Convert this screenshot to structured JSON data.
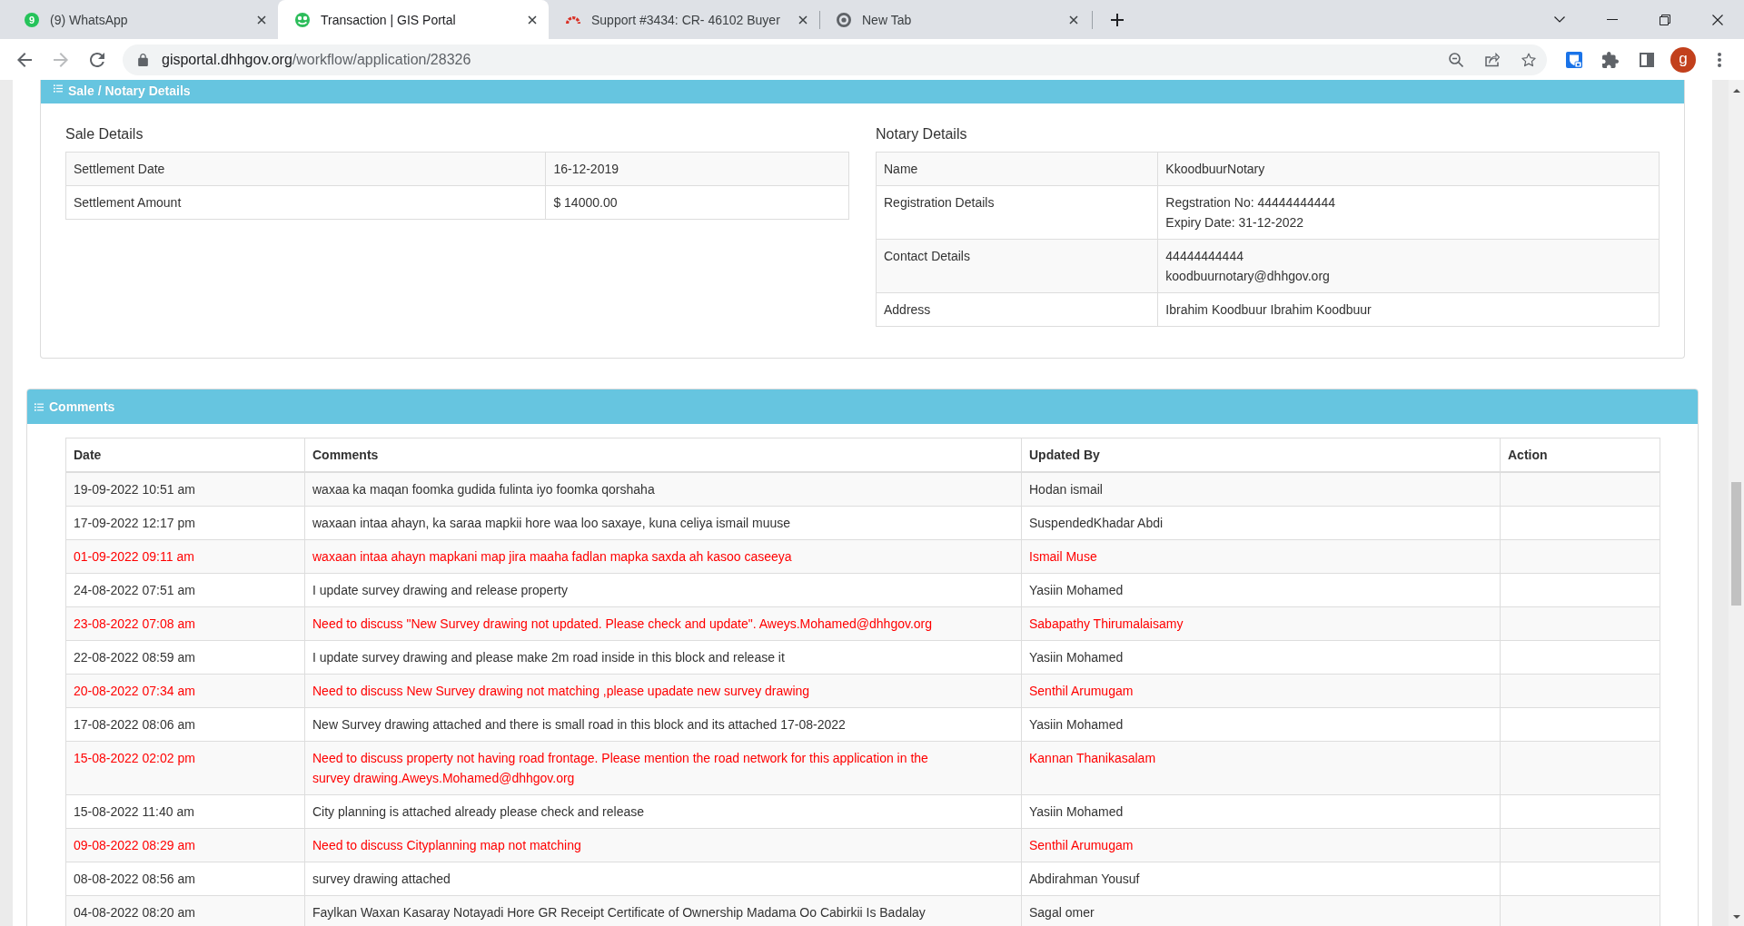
{
  "browser": {
    "tabs": [
      {
        "kind": "chat",
        "badge": "9",
        "title": "(9) WhatsApp",
        "selected": false
      },
      {
        "kind": "portal",
        "title": "Transaction | GIS Portal",
        "selected": true
      },
      {
        "kind": "gauge",
        "title": "Support #3434: CR- 46102 Buyer",
        "selected": false
      },
      {
        "kind": "browser",
        "title": "New Tab",
        "selected": false
      }
    ],
    "forward_disabled": true,
    "url": {
      "host": "gisportal.dhhgov.org",
      "path": "/workflow/application/28326"
    },
    "profile_initial": "g"
  },
  "sale_notary_panel": {
    "title": "Sale / Notary Details",
    "sale": {
      "heading": "Sale Details",
      "rows": [
        {
          "label": "Settlement Date",
          "value": [
            "16-12-2019"
          ]
        },
        {
          "label": "Settlement Amount",
          "value": [
            "$ 14000.00"
          ]
        }
      ]
    },
    "notary": {
      "heading": "Notary Details",
      "rows": [
        {
          "label": "Name",
          "value": [
            "KkoodbuurNotary"
          ]
        },
        {
          "label": "Registration Details",
          "value": [
            "Regstration No: 44444444444",
            "Expiry Date: 31-12-2022"
          ]
        },
        {
          "label": "Contact Details",
          "value": [
            "44444444444",
            "koodbuurnotary@dhhgov.org"
          ]
        },
        {
          "label": "Address",
          "value": [
            "Ibrahim Koodbuur Ibrahim Koodbuur"
          ]
        }
      ]
    }
  },
  "comments_panel": {
    "title": "Comments",
    "columns": [
      "Date",
      "Comments",
      "Updated By",
      "Action"
    ],
    "rows": [
      {
        "date": "19-09-2022 10:51 am",
        "comment": "waxaa ka maqan foomka gudida fulinta iyo foomka qorshaha",
        "updated_by": "Hodan ismail",
        "flagged": false
      },
      {
        "date": "17-09-2022 12:17 pm",
        "comment": "waxaan intaa ahayn, ka saraa mapkii hore waa loo saxaye, kuna celiya ismail muuse",
        "updated_by": "SuspendedKhadar Abdi",
        "flagged": false
      },
      {
        "date": "01-09-2022 09:11 am",
        "comment": "waxaan intaa ahayn mapkani map jira maaha fadlan mapka saxda ah kasoo caseeya",
        "updated_by": "Ismail Muse",
        "flagged": true
      },
      {
        "date": "24-08-2022 07:51 am",
        "comment": "I update survey drawing and release property",
        "updated_by": "Yasiin Mohamed",
        "flagged": false
      },
      {
        "date": "23-08-2022 07:08 am",
        "comment": "Need to discuss \"New Survey drawing not updated. Please check and update\". Aweys.Mohamed@dhhgov.org",
        "updated_by": "Sabapathy Thirumalaisamy",
        "flagged": true
      },
      {
        "date": "22-08-2022 08:59 am",
        "comment": "I update survey drawing and please make 2m road inside in this block and release it",
        "updated_by": "Yasiin Mohamed",
        "flagged": false
      },
      {
        "date": "20-08-2022 07:34 am",
        "comment": "Need to discuss New Survey drawing not matching ,please upadate new survey drawing",
        "updated_by": "Senthil Arumugam",
        "flagged": true
      },
      {
        "date": "17-08-2022 08:06 am",
        "comment": "New Survey drawing attached and there is small road in this block and its attached 17-08-2022",
        "updated_by": "Yasiin Mohamed",
        "flagged": false
      },
      {
        "date": "15-08-2022 02:02 pm",
        "comment": "Need to discuss property not having road frontage. Please mention the road network for this application in the survey drawing.Aweys.Mohamed@dhhgov.org",
        "updated_by": "Kannan Thanikasalam",
        "flagged": true
      },
      {
        "date": "15-08-2022 11:40 am",
        "comment": "City planning is attached already please check and release",
        "updated_by": "Yasiin Mohamed",
        "flagged": false
      },
      {
        "date": "09-08-2022 08:29 am",
        "comment": "Need to discuss Cityplanning map not matching",
        "updated_by": "Senthil Arumugam",
        "flagged": true
      },
      {
        "date": "08-08-2022 08:56 am",
        "comment": "survey drawing attached",
        "updated_by": "Abdirahman Yousuf",
        "flagged": false
      },
      {
        "date": "04-08-2022 08:20 am",
        "comment": "Faylkan Waxan Kasaray Notayadi Hore GR Receipt Certificate of Ownership Madama Oo Cabirkii Is Badalay",
        "updated_by": "Sagal omer",
        "flagged": false
      }
    ]
  }
}
